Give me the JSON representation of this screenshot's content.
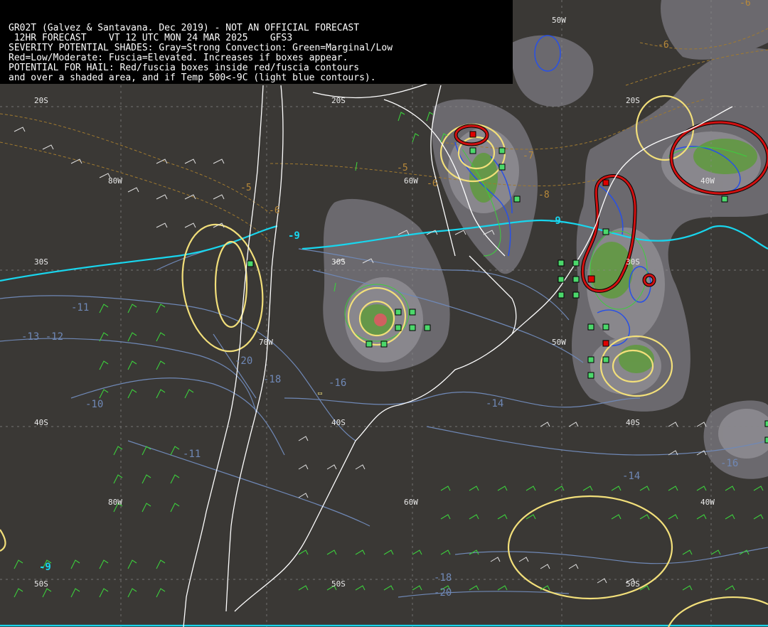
{
  "header": {
    "line1": "GR02T (Galvez & Santavana. Dec 2019) - NOT AN OFFICIAL FORECAST",
    "line2": " 12HR FORECAST    VT 12 UTC MON 24 MAR 2025    GFS3",
    "line3": "SEVERITY POTENTIAL SHADES: Gray=Strong Convection: Green=Marginal/Low",
    "line4": "Red=Low/Moderate: Fuscia=Elevated. Increases if boxes appear.",
    "line5": "POTENTIAL FOR HAIL: Red/fuscia boxes inside red/fuscia contours",
    "line6": "and over a shaded area, and if Temp 500<-9C (light blue contours)."
  },
  "grid_labels": {
    "lat_20s_a": "20S",
    "lat_20s_b": "20S",
    "lat_20s_c": "20S",
    "lat_30s_a": "30S",
    "lat_30s_b": "30S",
    "lat_30s_c": "30S",
    "lat_40s_a": "40S",
    "lat_40s_b": "40S",
    "lat_40s_c": "40S",
    "lat_50s_a": "50S",
    "lat_50s_b": "50S",
    "lat_50s_c": "50S",
    "lon_80w_a": "80W",
    "lon_80w_b": "80W",
    "lon_70w": "70W",
    "lon_60w_a": "60W",
    "lon_60w_b": "60W",
    "lon_50w_a": "50W",
    "lon_50w_b": "50W",
    "lon_40w_a": "40W",
    "lon_40w_b": "40W"
  },
  "contour_labels": {
    "t_m9_a": "-9",
    "t_m9_b": "-9",
    "t_m9_c": "-9",
    "t_m11": "-11",
    "t_m13_12": "-13 -12",
    "t_m20": "-20",
    "t_m18_a": "-18",
    "t_m16_a": "-16",
    "t_m10": "-10",
    "t_m14_a": "-14",
    "t_m14_b": "-14",
    "t_m16_b": "-16",
    "t_m18_b": "-18",
    "t_m20_b": "-20",
    "t_m11_b": "-11",
    "d_m5_a": "-5",
    "d_m6_a": "-6",
    "d_m5_b": "-5",
    "d_m6_b": "-6",
    "d_m7": "-7",
    "d_m8": "-8",
    "d_m6_c": "-6",
    "d_m6_d": "-6"
  },
  "colors": {
    "background": "#3a3835",
    "gray_shade": "#6e6c72",
    "gray_shade_light": "#8d8b90",
    "green_shade": "#5f9a3d",
    "red_box": "#e00000",
    "green_box": "#4cd86b",
    "yellow_contour": "#f2df7a",
    "cyan_contour": "#18d6ee",
    "blue_contour": "#2850e6",
    "slate_contour": "#6f88b6",
    "dashed_orange": "#a07a30",
    "coastline": "#ffffff",
    "wind_green": "#3ccf3c",
    "wind_white": "#e0e0e0"
  }
}
